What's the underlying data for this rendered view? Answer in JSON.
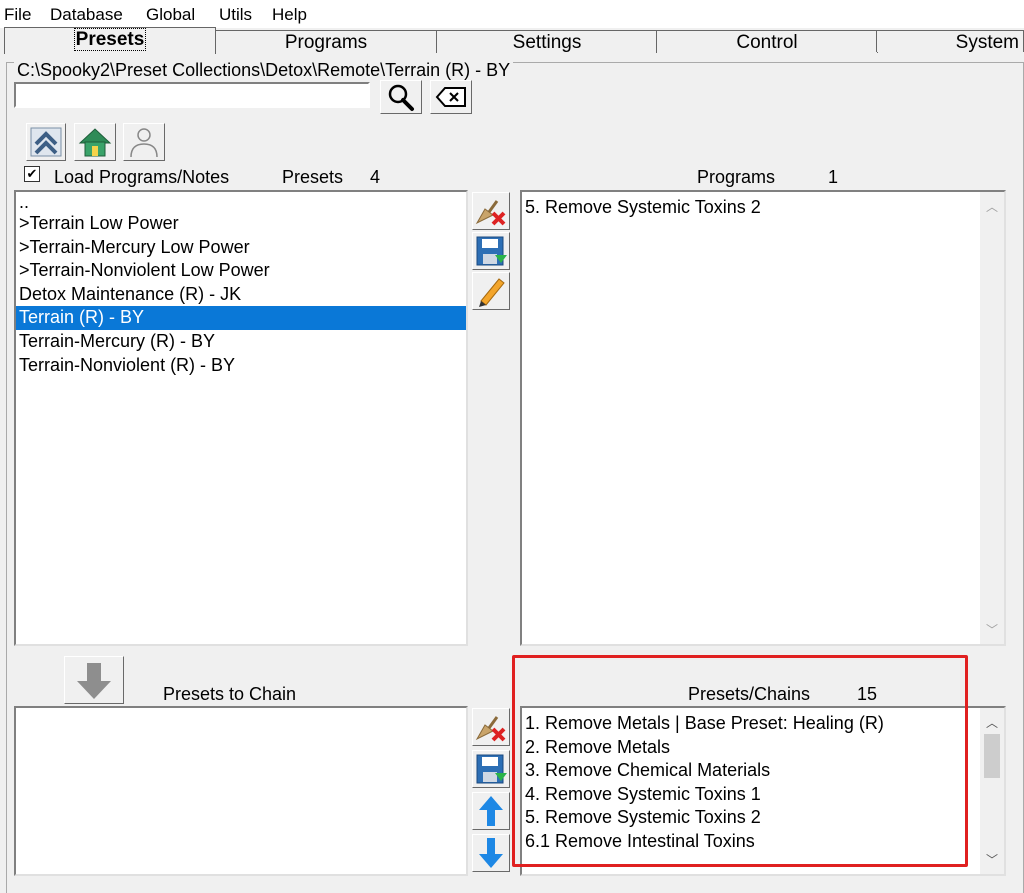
{
  "menu": {
    "file": "File",
    "database": "Database",
    "global": "Global",
    "utils": "Utils",
    "help": "Help"
  },
  "tabs": [
    "Presets",
    "Programs",
    "Settings",
    "Control",
    "System"
  ],
  "path_title": "C:\\Spooky2\\Preset Collections\\Detox\\Remote\\Terrain (R) - BY",
  "search": {
    "value": "",
    "placeholder": ""
  },
  "load_programs_notes": {
    "label": "Load Programs/Notes",
    "checked": true
  },
  "presets": {
    "label": "Presets",
    "count": "4",
    "items": [
      "..",
      ">Terrain Low Power",
      ">Terrain-Mercury Low Power",
      ">Terrain-Nonviolent Low Power",
      "Detox Maintenance (R) - JK",
      "Terrain (R) - BY",
      "Terrain-Mercury (R) - BY",
      "Terrain-Nonviolent (R) - BY"
    ],
    "selected_index": 5
  },
  "programs": {
    "label": "Programs",
    "count": "1",
    "items": [
      "5. Remove Systemic Toxins 2"
    ]
  },
  "presets_to_chain": {
    "label": "Presets to Chain",
    "items": []
  },
  "presets_chains": {
    "label": "Presets/Chains",
    "count": "15",
    "items": [
      "1. Remove Metals    | Base Preset: Healing (R)",
      "2. Remove Metals",
      "3. Remove Chemical Materials",
      "4. Remove Systemic Toxins 1",
      "5. Remove Systemic Toxins 2",
      "6.1 Remove Intestinal Toxins"
    ]
  },
  "colors": {
    "selection": "#0a78d7",
    "highlight_border": "#e02020",
    "accent_green": "#2e8b57"
  }
}
